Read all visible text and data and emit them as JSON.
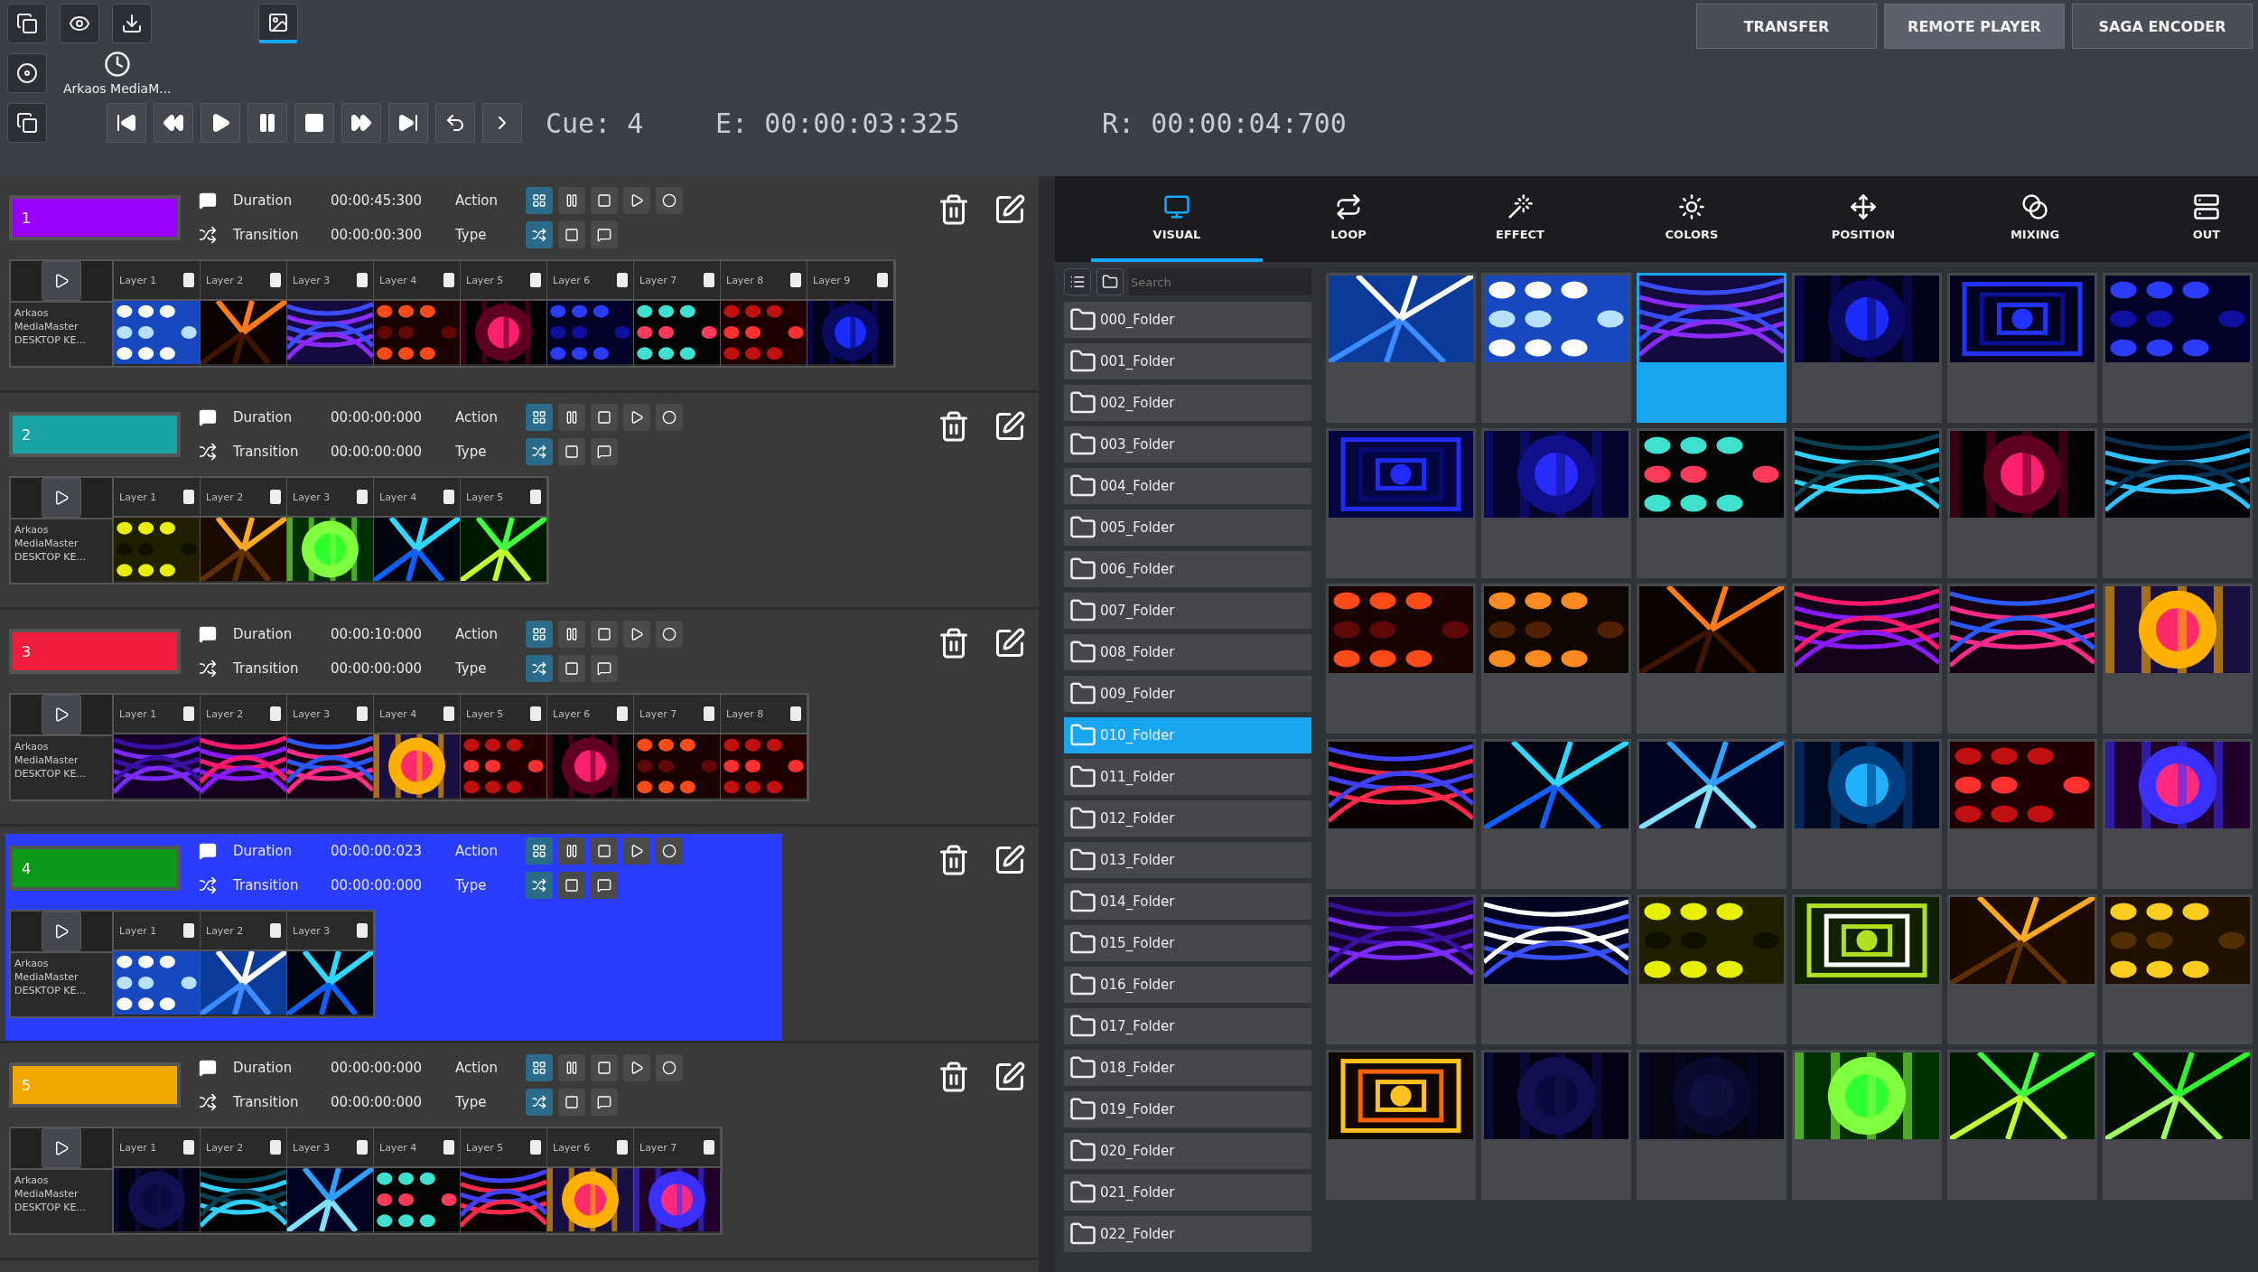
{
  "top_bar": {
    "source_label": "Arkaos MediaM...",
    "buttons": [
      {
        "label": "TRANSFER",
        "selected": false
      },
      {
        "label": "REMOTE PLAYER",
        "selected": true
      },
      {
        "label": "SAGA ENCODER",
        "selected": false
      }
    ]
  },
  "transport": {
    "cue": "Cue: 4",
    "elapsed": "E: 00:00:03:325",
    "remaining": "R: 00:00:04:700"
  },
  "cues": [
    {
      "label": "1",
      "color": "#9b00ff",
      "selected": false,
      "duration_label": "Duration",
      "duration": "00:00:45:300",
      "action_label": "Action",
      "transition_label": "Transition",
      "transition": "00:00:00:300",
      "type_label": "Type",
      "source": [
        "Arkaos",
        "MediaMaster",
        "DESKTOP KE..."
      ],
      "layers": [
        {
          "label": "Layer 1",
          "checked": true
        },
        {
          "label": "Layer 2",
          "checked": true
        },
        {
          "label": "Layer 3",
          "checked": true
        },
        {
          "label": "Layer 4",
          "checked": true
        },
        {
          "label": "Layer 5",
          "checked": true
        },
        {
          "label": "Layer 6",
          "checked": true
        },
        {
          "label": "Layer 7",
          "checked": true
        },
        {
          "label": "Layer 8",
          "checked": true
        },
        {
          "label": "Layer 9",
          "checked": true
        }
      ]
    },
    {
      "label": "2",
      "color": "#1aa3a3",
      "selected": false,
      "duration_label": "Duration",
      "duration": "00:00:00:000",
      "action_label": "Action",
      "transition_label": "Transition",
      "transition": "00:00:00:000",
      "type_label": "Type",
      "source": [
        "Arkaos",
        "MediaMaster",
        "DESKTOP KE..."
      ],
      "layers": [
        {
          "label": "Layer 1",
          "checked": true
        },
        {
          "label": "Layer 2",
          "checked": true
        },
        {
          "label": "Layer 3",
          "checked": true
        },
        {
          "label": "Layer 4",
          "checked": true
        },
        {
          "label": "Layer 5",
          "checked": true
        }
      ]
    },
    {
      "label": "3",
      "color": "#f01e3c",
      "selected": false,
      "duration_label": "Duration",
      "duration": "00:00:10:000",
      "action_label": "Action",
      "transition_label": "Transition",
      "transition": "00:00:00:000",
      "type_label": "Type",
      "source": [
        "Arkaos",
        "MediaMaster",
        "DESKTOP KE..."
      ],
      "layers": [
        {
          "label": "Layer 1",
          "checked": true
        },
        {
          "label": "Layer 2",
          "checked": true
        },
        {
          "label": "Layer 3",
          "checked": true
        },
        {
          "label": "Layer 4",
          "checked": true
        },
        {
          "label": "Layer 5",
          "checked": true
        },
        {
          "label": "Layer 6",
          "checked": true
        },
        {
          "label": "Layer 7",
          "checked": true
        },
        {
          "label": "Layer 8",
          "checked": true
        }
      ]
    },
    {
      "label": "4",
      "color": "#0b9a1a",
      "selected": true,
      "duration_label": "Duration",
      "duration": "00:00:00:023",
      "action_label": "Action",
      "transition_label": "Transition",
      "transition": "00:00:00:000",
      "type_label": "Type",
      "source": [
        "Arkaos",
        "MediaMaster",
        "DESKTOP KE..."
      ],
      "layers": [
        {
          "label": "Layer 1",
          "checked": true
        },
        {
          "label": "Layer 2",
          "checked": true
        },
        {
          "label": "Layer 3",
          "checked": true
        }
      ]
    },
    {
      "label": "5",
      "color": "#f0a800",
      "selected": false,
      "duration_label": "Duration",
      "duration": "00:00:00:000",
      "action_label": "Action",
      "transition_label": "Transition",
      "transition": "00:00:00:000",
      "type_label": "Type",
      "source": [
        "Arkaos",
        "MediaMaster",
        "DESKTOP KE..."
      ],
      "layers": [
        {
          "label": "Layer 1",
          "checked": true
        },
        {
          "label": "Layer 2",
          "checked": true
        },
        {
          "label": "Layer 3",
          "checked": true
        },
        {
          "label": "Layer 4",
          "checked": true
        },
        {
          "label": "Layer 5",
          "checked": true
        },
        {
          "label": "Layer 6",
          "checked": true
        },
        {
          "label": "Layer 7",
          "checked": true
        }
      ]
    }
  ],
  "library_tabs": [
    {
      "label": "VISUAL",
      "selected": true
    },
    {
      "label": "LOOP",
      "selected": false
    },
    {
      "label": "EFFECT",
      "selected": false
    },
    {
      "label": "COLORS",
      "selected": false
    },
    {
      "label": "POSITION",
      "selected": false
    },
    {
      "label": "MIXING",
      "selected": false
    },
    {
      "label": "OUT",
      "selected": false
    }
  ],
  "search": {
    "placeholder": "Search"
  },
  "folders": [
    {
      "name": "000_Folder",
      "selected": false
    },
    {
      "name": "001_Folder",
      "selected": false
    },
    {
      "name": "002_Folder",
      "selected": false
    },
    {
      "name": "003_Folder",
      "selected": false
    },
    {
      "name": "004_Folder",
      "selected": false
    },
    {
      "name": "005_Folder",
      "selected": false
    },
    {
      "name": "006_Folder",
      "selected": false
    },
    {
      "name": "007_Folder",
      "selected": false
    },
    {
      "name": "008_Folder",
      "selected": false
    },
    {
      "name": "009_Folder",
      "selected": false
    },
    {
      "name": "010_Folder",
      "selected": true
    },
    {
      "name": "011_Folder",
      "selected": false
    },
    {
      "name": "012_Folder",
      "selected": false
    },
    {
      "name": "013_Folder",
      "selected": false
    },
    {
      "name": "014_Folder",
      "selected": false
    },
    {
      "name": "015_Folder",
      "selected": false
    },
    {
      "name": "016_Folder",
      "selected": false
    },
    {
      "name": "017_Folder",
      "selected": false
    },
    {
      "name": "018_Folder",
      "selected": false
    },
    {
      "name": "019_Folder",
      "selected": false
    },
    {
      "name": "020_Folder",
      "selected": false
    },
    {
      "name": "021_Folder",
      "selected": false
    },
    {
      "name": "022_Folder",
      "selected": false
    }
  ],
  "visuals": [
    {
      "kind": "picture",
      "selected": false
    },
    {
      "kind": "picture",
      "selected": false
    },
    {
      "kind": "picture",
      "selected": true
    },
    {
      "kind": "picture",
      "selected": false
    },
    {
      "kind": "picture",
      "selected": false
    },
    {
      "kind": "picture",
      "selected": false
    },
    {
      "kind": "picture",
      "selected": false
    },
    {
      "kind": "picture",
      "selected": false
    },
    {
      "kind": "picture",
      "selected": false
    },
    {
      "kind": "picture",
      "selected": false
    },
    {
      "kind": "picture",
      "selected": false
    },
    {
      "kind": "picture",
      "selected": false
    },
    {
      "kind": "picture",
      "selected": false
    },
    {
      "kind": "picture",
      "selected": false
    },
    {
      "kind": "picture",
      "selected": false
    },
    {
      "kind": "picture",
      "selected": false
    },
    {
      "kind": "picture",
      "selected": false
    },
    {
      "kind": "picture",
      "selected": false
    },
    {
      "kind": "picture",
      "selected": false
    },
    {
      "kind": "picture",
      "selected": false
    },
    {
      "kind": "picture",
      "selected": false
    },
    {
      "kind": "picture",
      "selected": false
    },
    {
      "kind": "picture",
      "selected": false
    },
    {
      "kind": "picture",
      "selected": false
    },
    {
      "kind": "picture",
      "selected": false
    },
    {
      "kind": "picture",
      "selected": false
    },
    {
      "kind": "picture",
      "selected": false
    },
    {
      "kind": "picture",
      "selected": false
    },
    {
      "kind": "picture",
      "selected": false
    },
    {
      "kind": "picture",
      "selected": false
    },
    {
      "kind": "picture",
      "selected": false
    },
    {
      "kind": "picture",
      "selected": false
    },
    {
      "kind": "picture",
      "selected": false
    },
    {
      "kind": "picture",
      "selected": false
    },
    {
      "kind": "picture",
      "selected": false
    },
    {
      "kind": "picture",
      "selected": false
    }
  ]
}
